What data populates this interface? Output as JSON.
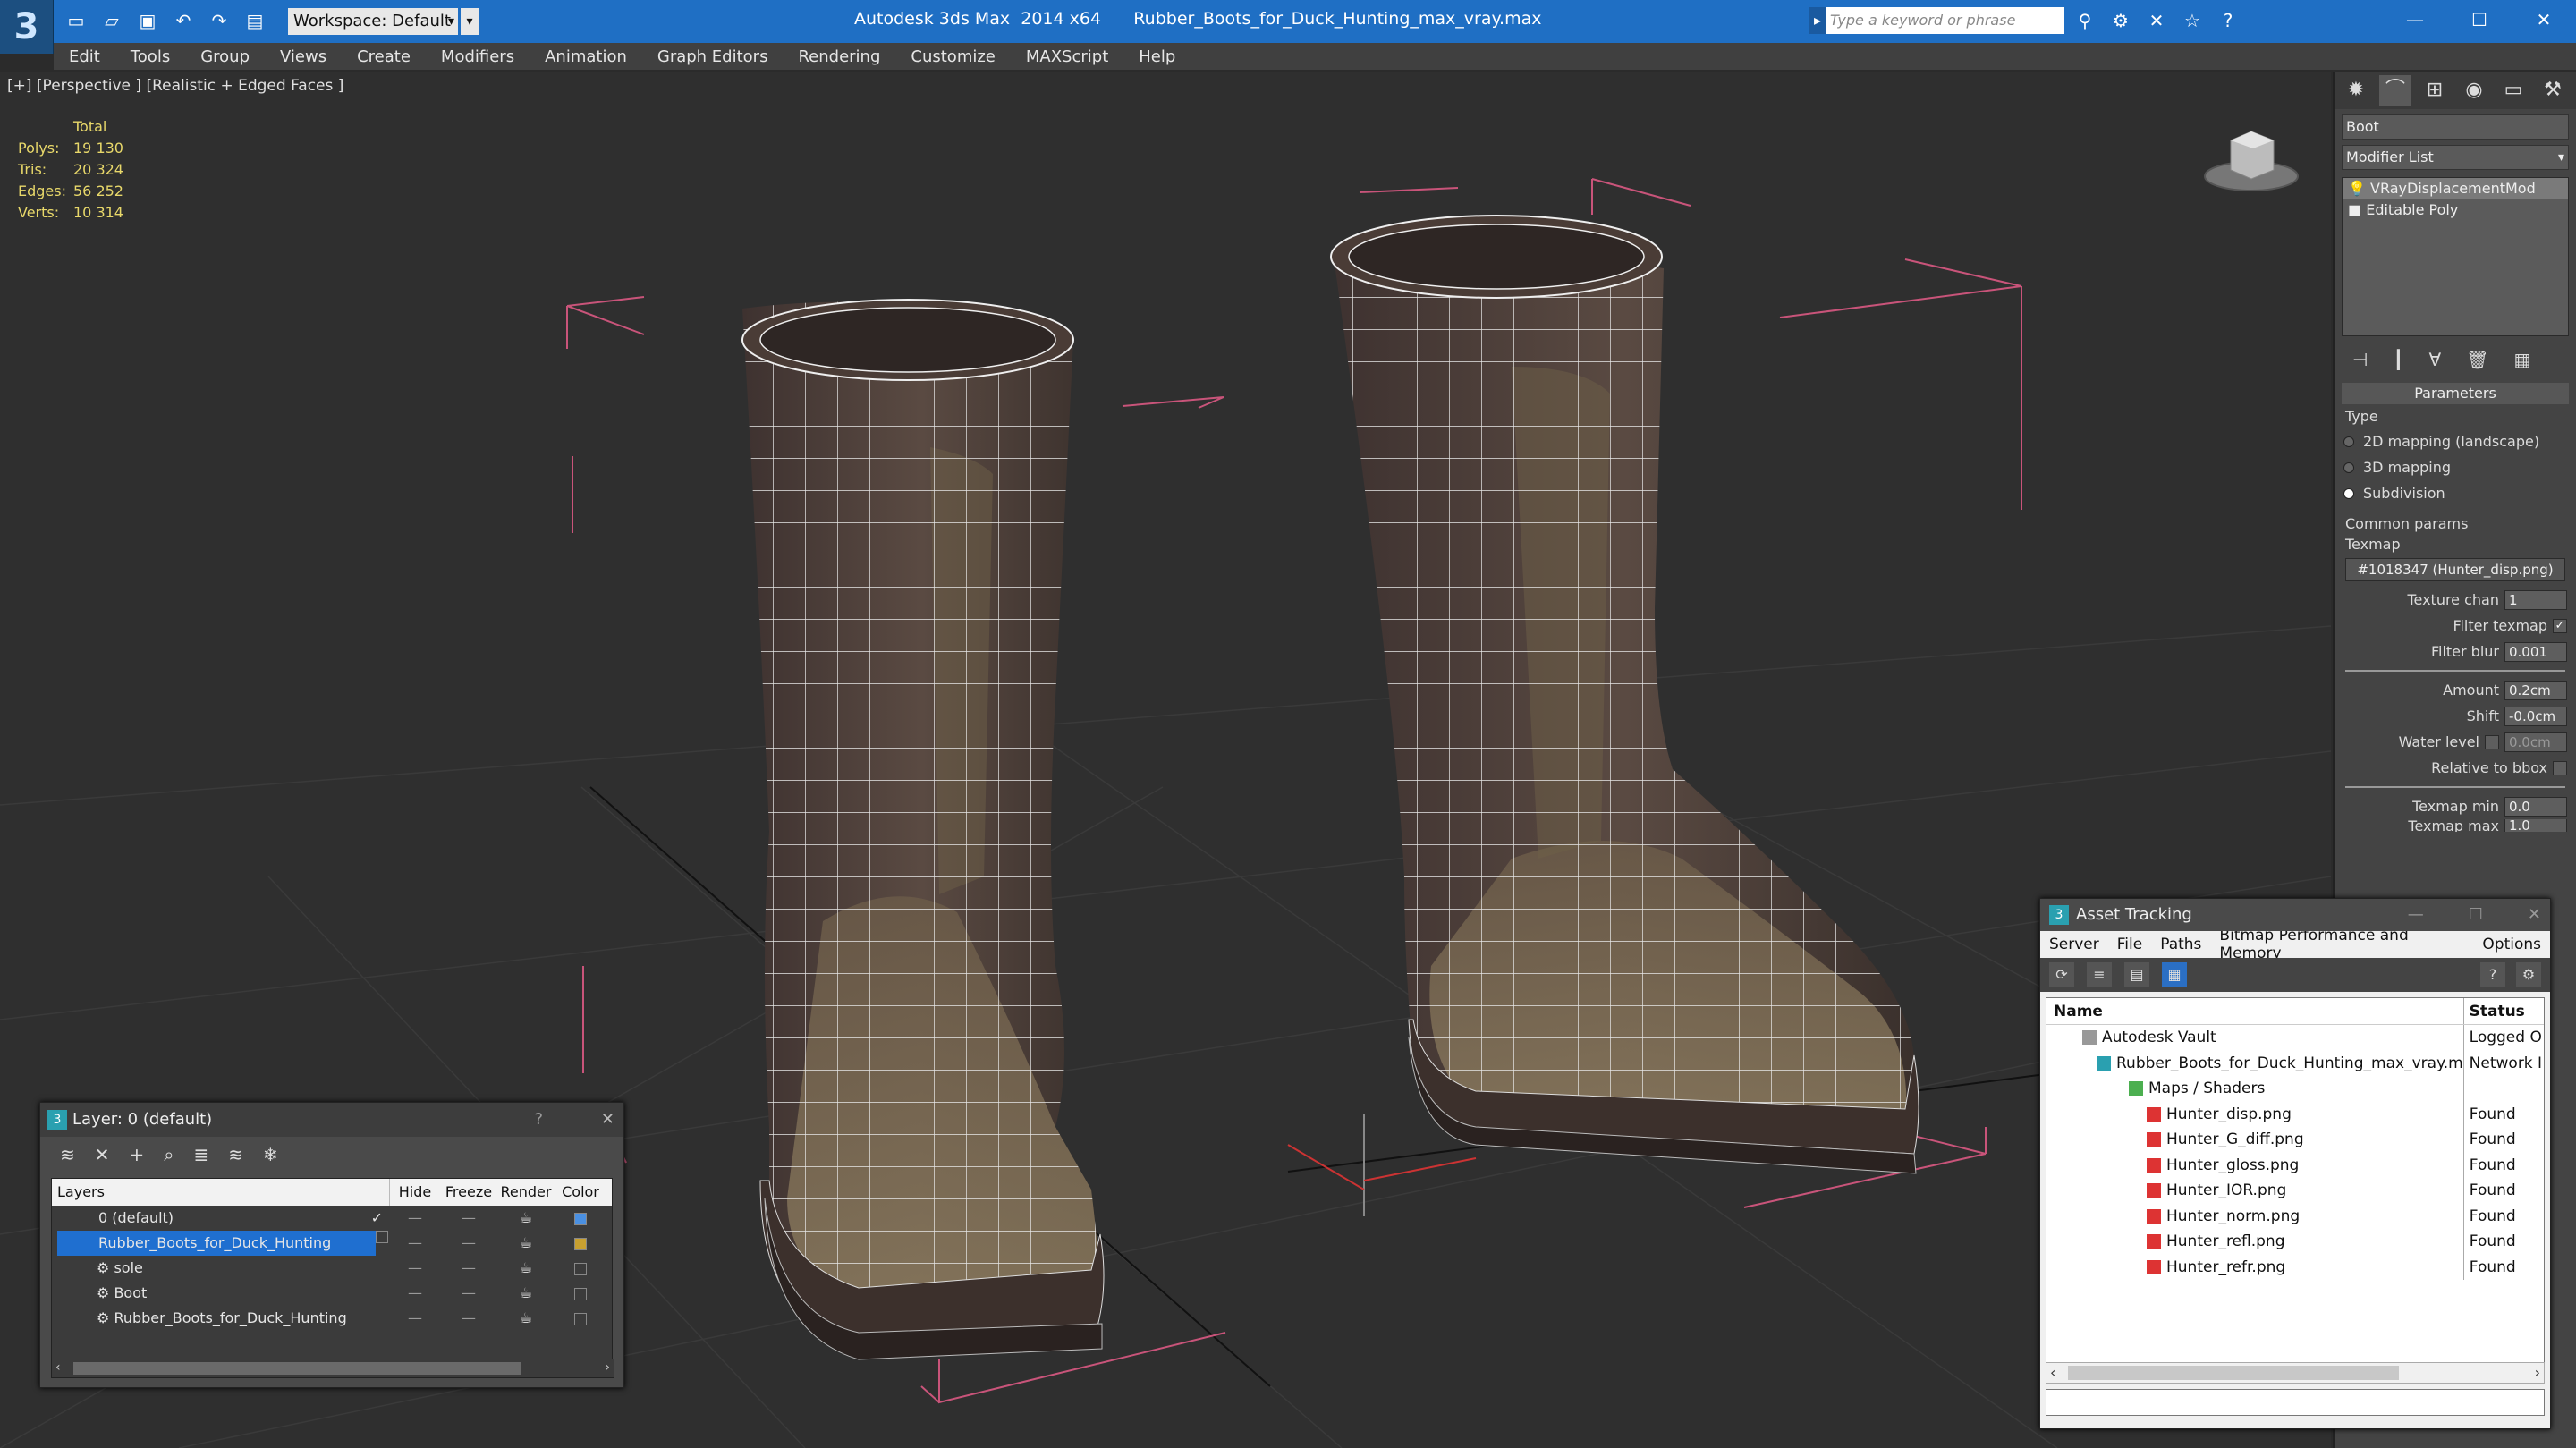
{
  "app": {
    "workspace": "Workspace: Default",
    "title": "Autodesk 3ds Max  2014 x64      Rubber_Boots_for_Duck_Hunting_max_vray.max",
    "search_placeholder": "Type a keyword or phrase"
  },
  "menu": [
    "Edit",
    "Tools",
    "Group",
    "Views",
    "Create",
    "Modifiers",
    "Animation",
    "Graph Editors",
    "Rendering",
    "Customize",
    "MAXScript",
    "Help"
  ],
  "viewport": {
    "label": "[+] [Perspective ] [Realistic + Edged Faces ]",
    "stats": {
      "header": "Total",
      "rows": [
        {
          "k": "Polys:",
          "v": "19 130"
        },
        {
          "k": "Tris:",
          "v": "20 324"
        },
        {
          "k": "Edges:",
          "v": "56 252"
        },
        {
          "k": "Verts:",
          "v": "10 314"
        }
      ]
    }
  },
  "command_panel": {
    "object_name": "Boot",
    "modifier_list": "Modifier List",
    "stack": [
      "VRayDisplacementMod",
      "Editable Poly"
    ],
    "rollout": "Parameters",
    "type_label": "Type",
    "types": [
      {
        "label": "2D mapping (landscape)",
        "selected": false
      },
      {
        "label": "3D mapping",
        "selected": false
      },
      {
        "label": "Subdivision",
        "selected": true
      }
    ],
    "common_params": "Common params",
    "texmap_label": "Texmap",
    "texmap_value": "#1018347 (Hunter_disp.png)",
    "texture_chan_label": "Texture chan",
    "texture_chan": "1",
    "filter_texmap_label": "Filter texmap",
    "filter_blur_label": "Filter blur",
    "filter_blur": "0.001",
    "amount_label": "Amount",
    "amount": "0.2cm",
    "shift_label": "Shift",
    "shift": "-0.0cm",
    "water_level_label": "Water level",
    "water_level": "0.0cm",
    "relative_bbox_label": "Relative to bbox",
    "texmap_min_label": "Texmap min",
    "texmap_min": "0.0",
    "texmap_max_label": "Texmap max",
    "texmap_max": "1.0"
  },
  "layer_dialog": {
    "title": "Layer: 0 (default)",
    "columns": [
      "Layers",
      "Hide",
      "Freeze",
      "Render",
      "Color"
    ],
    "rows": [
      {
        "name": "0 (default)",
        "color": "#4a90e2",
        "selected": false
      },
      {
        "name": "Rubber_Boots_for_Duck_Hunting",
        "color": "#c8a030",
        "selected": true
      },
      {
        "name": "sole",
        "color": "#3b3b3b",
        "selected": false
      },
      {
        "name": "Boot",
        "color": "#3b3b3b",
        "selected": false
      },
      {
        "name": "Rubber_Boots_for_Duck_Hunting",
        "color": "#3b3b3b",
        "selected": false
      }
    ]
  },
  "asset_tracking": {
    "title": "Asset Tracking",
    "menu": [
      "Server",
      "File",
      "Paths",
      "Bitmap Performance and Memory",
      "Options"
    ],
    "columns": [
      "Name",
      "Status"
    ],
    "rows": [
      {
        "name": "Autodesk Vault",
        "status": "Logged O",
        "indent": 1
      },
      {
        "name": "Rubber_Boots_for_Duck_Hunting_max_vray.max",
        "status": "Network I",
        "indent": 2
      },
      {
        "name": "Maps / Shaders",
        "status": "",
        "indent": 3
      },
      {
        "name": "Hunter_disp.png",
        "status": "Found",
        "indent": 4
      },
      {
        "name": "Hunter_G_diff.png",
        "status": "Found",
        "indent": 4
      },
      {
        "name": "Hunter_gloss.png",
        "status": "Found",
        "indent": 4
      },
      {
        "name": "Hunter_IOR.png",
        "status": "Found",
        "indent": 4
      },
      {
        "name": "Hunter_norm.png",
        "status": "Found",
        "indent": 4
      },
      {
        "name": "Hunter_refl.png",
        "status": "Found",
        "indent": 4
      },
      {
        "name": "Hunter_refr.png",
        "status": "Found",
        "indent": 4
      }
    ]
  }
}
